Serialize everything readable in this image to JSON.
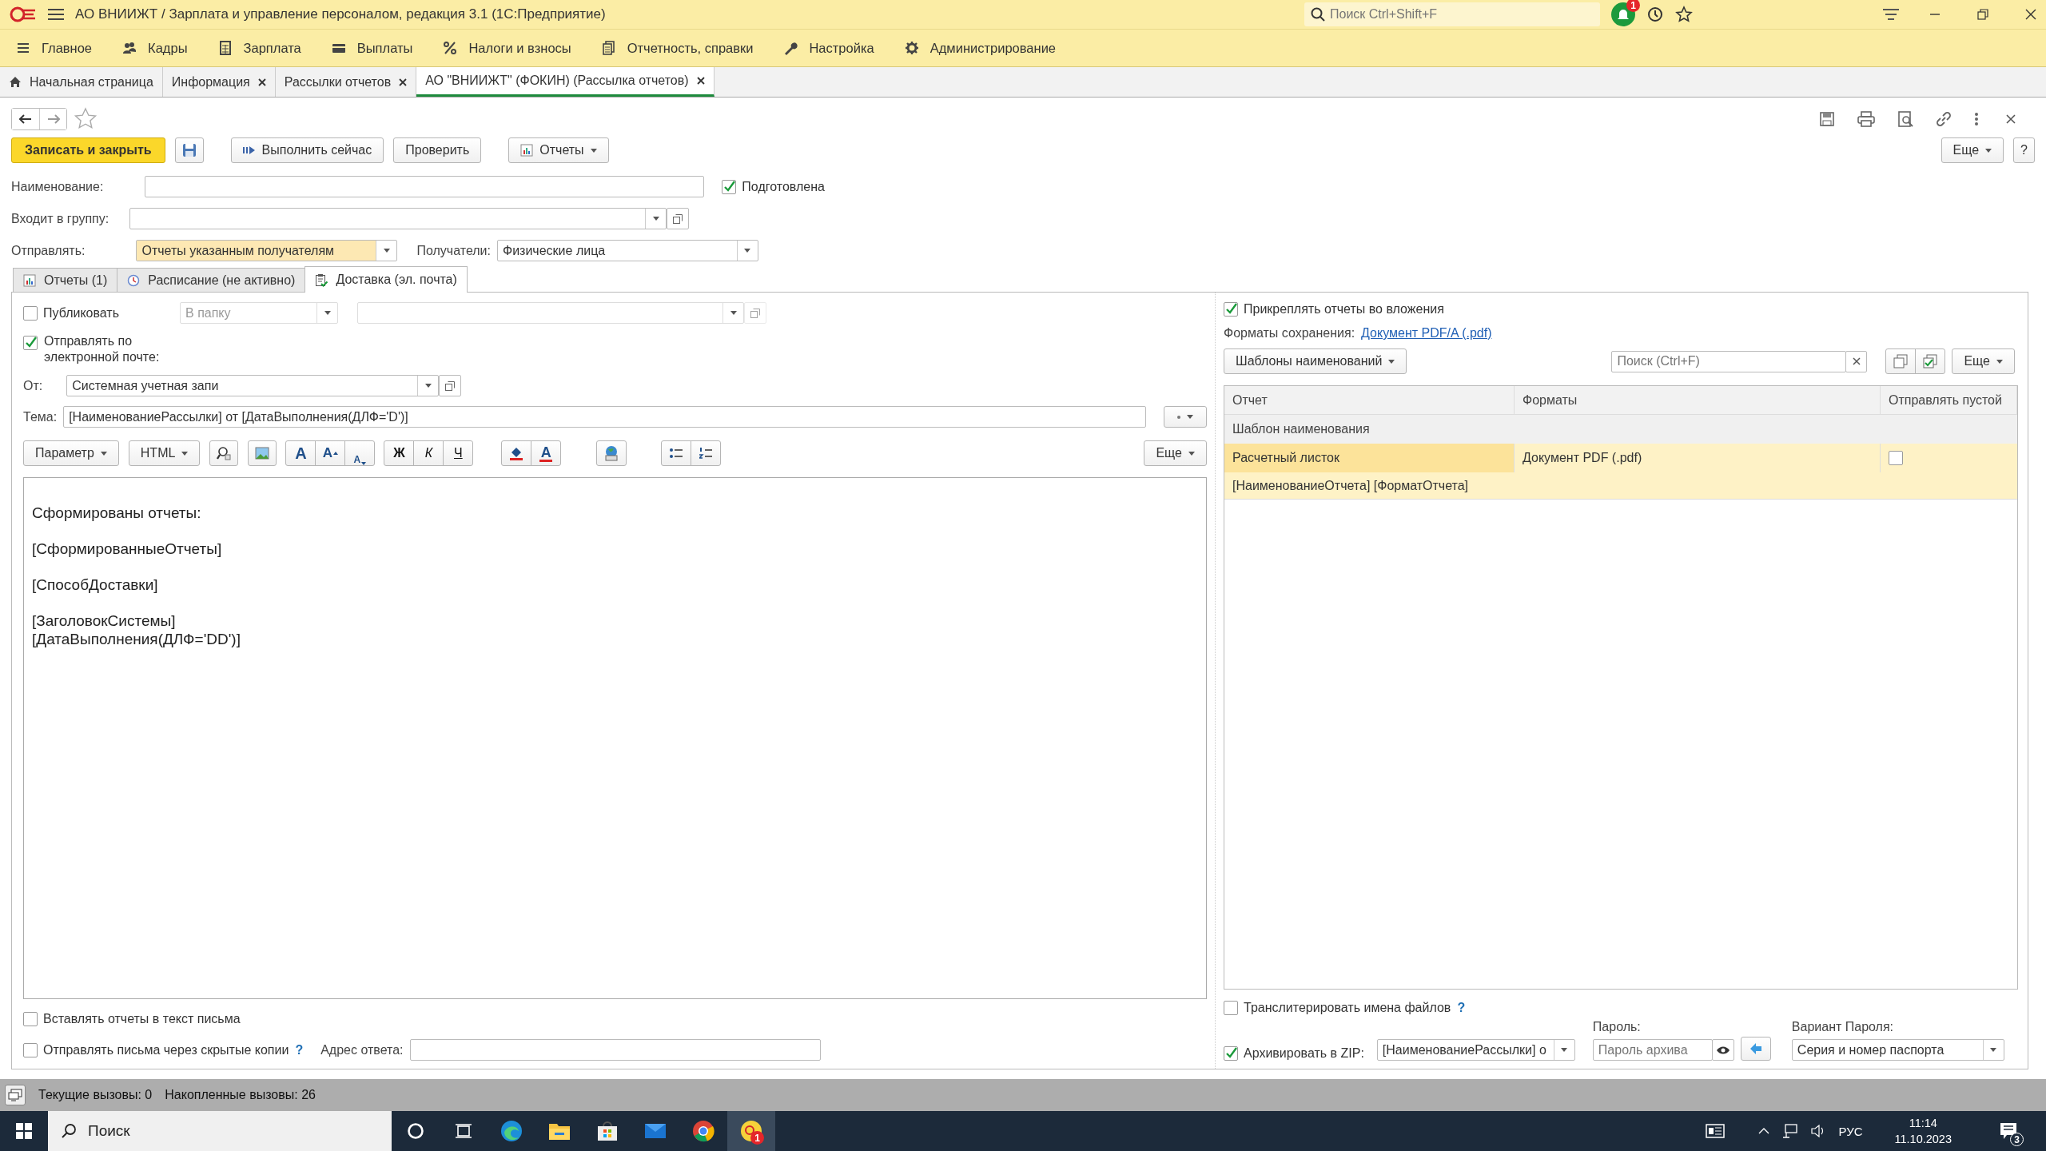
{
  "window": {
    "title": "АО ВНИИЖТ / Зарплата и управление персоналом, редакция 3.1  (1С:Предприятие)",
    "search_placeholder": "Поиск Ctrl+Shift+F",
    "notifications": "1"
  },
  "sections": [
    {
      "label": "Главное",
      "kind": "menu"
    },
    {
      "label": "Кадры",
      "kind": "people"
    },
    {
      "label": "Зарплата",
      "kind": "calc"
    },
    {
      "label": "Выплаты",
      "kind": "wallet"
    },
    {
      "label": "Налоги и взносы",
      "kind": "percent"
    },
    {
      "label": "Отчетность, справки",
      "kind": "docs"
    },
    {
      "label": "Настройка",
      "kind": "wrench"
    },
    {
      "label": "Администрирование",
      "kind": "gear"
    }
  ],
  "open_tabs": [
    {
      "label": "Начальная страница",
      "kind": "home",
      "selected": false
    },
    {
      "label": "Информация",
      "kind": "closable",
      "selected": false
    },
    {
      "label": "Рассылки отчетов",
      "kind": "closable",
      "selected": false
    },
    {
      "label": "АО \"ВНИИЖТ\" (ФОКИН) (Рассылка отчетов)",
      "kind": "closable",
      "selected": true
    }
  ],
  "command_bar": {
    "save_close": "Записать и закрыть",
    "run_now": "Выполнить сейчас",
    "check": "Проверить",
    "reports": "Отчеты",
    "more": "Еще",
    "help": "?"
  },
  "header": {
    "name_label": "Наименование:",
    "prepared": {
      "label": "Подготовлена",
      "checked": true
    },
    "group_label": "Входит в группу:",
    "send_label": "Отправлять:",
    "send_value": "Отчеты указанным получателям",
    "recipients_label": "Получатели:",
    "recipients_value": "Физические лица"
  },
  "form_tabs": [
    {
      "label": "Отчеты (1)",
      "kind": "chart",
      "selected": false
    },
    {
      "label": "Расписание (не активно)",
      "kind": "clock",
      "selected": false
    },
    {
      "label": "Доставка (эл. почта)",
      "kind": "clipboard",
      "selected": true
    }
  ],
  "delivery": {
    "publish": {
      "label": "Публиковать",
      "checked": false
    },
    "publish_target": "В папку",
    "email": {
      "label": "Отправлять по электронной почте:",
      "checked": true
    },
    "from_label": "От:",
    "from_value": "Системная учетная запи",
    "subject_label": "Тема:",
    "subject_value": "[НаименованиеРассылки] от [ДатаВыполнения(ДЛФ='D')]",
    "editor_toolbar": {
      "parameter": "Параметр",
      "format": "HTML",
      "size_buttons": [
        "A",
        "A",
        "A"
      ],
      "style_buttons": [
        "Ж",
        "К",
        "Ч"
      ],
      "text_color": "A",
      "more": "Еще"
    },
    "body": [
      [
        "Сформированы отчеты:"
      ],
      [
        "[СформированныеОтчеты]"
      ],
      [
        "[СпособДоставки]"
      ],
      [
        "[ЗаголовокСистемы]",
        "[ДатаВыполнения(ДЛФ='DD')]"
      ]
    ],
    "insert_reports": {
      "label": "Вставлять отчеты в текст письма",
      "checked": false
    },
    "bcc": {
      "label": "Отправлять письма через скрытые копии",
      "checked": false
    },
    "help": "?",
    "reply_label": "Адрес ответа:"
  },
  "attachments": {
    "attach": {
      "label": "Прикреплять отчеты во вложения",
      "checked": true
    },
    "formats_label": "Форматы сохранения:",
    "formats_link": "Документ PDF/A (.pdf)",
    "templates_button": "Шаблоны наименований",
    "search_placeholder": "Поиск (Ctrl+F)",
    "more": "Еще",
    "table": {
      "columns": [
        "Отчет",
        "Форматы",
        "Отправлять пустой"
      ],
      "group": "Шаблон наименования",
      "rows": [
        {
          "report": "Расчетный листок",
          "formats": "Документ PDF (.pdf)",
          "send_empty": false,
          "template": "[НаименованиеОтчета] [ФорматОтчета]",
          "selected": true
        }
      ]
    },
    "transliterate": {
      "label": "Транслитерировать имена файлов",
      "checked": false
    },
    "help": "?",
    "zip": {
      "label": "Архивировать в ZIP:",
      "checked": true,
      "value": "[НаименованиеРассылки] о"
    },
    "password_label": "Пароль:",
    "password_placeholder": "Пароль архива",
    "variant_label": "Вариант Пароля:",
    "variant_value": "Серия и номер паспорта"
  },
  "status_bar": {
    "current": "Текущие вызовы: 0",
    "accumulated": "Накопленные вызовы: 26"
  },
  "taskbar": {
    "search": "Поиск",
    "language": "РУС",
    "time": "11:14",
    "date": "11.10.2023",
    "notifications": "3",
    "app_badge": "1"
  }
}
